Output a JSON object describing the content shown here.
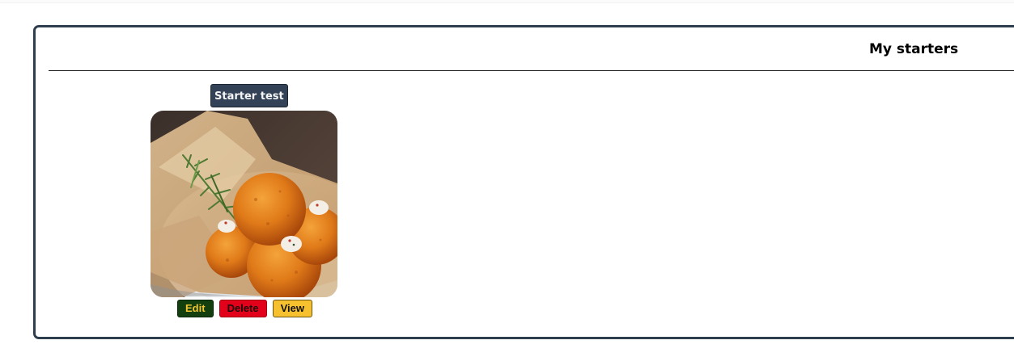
{
  "page": {
    "title": "My starters"
  },
  "card": {
    "title": "Starter test",
    "image_alt": "fried arancini balls with rosemary",
    "actions": {
      "edit": "Edit",
      "delete": "Delete",
      "view": "View"
    }
  },
  "colors": {
    "panel_border": "#2f3e4f",
    "title_badge_bg": "#334257",
    "edit_bg": "#123f0d",
    "edit_text": "#f2c531",
    "delete_bg": "#e3001a",
    "view_bg": "#f7c02f"
  }
}
